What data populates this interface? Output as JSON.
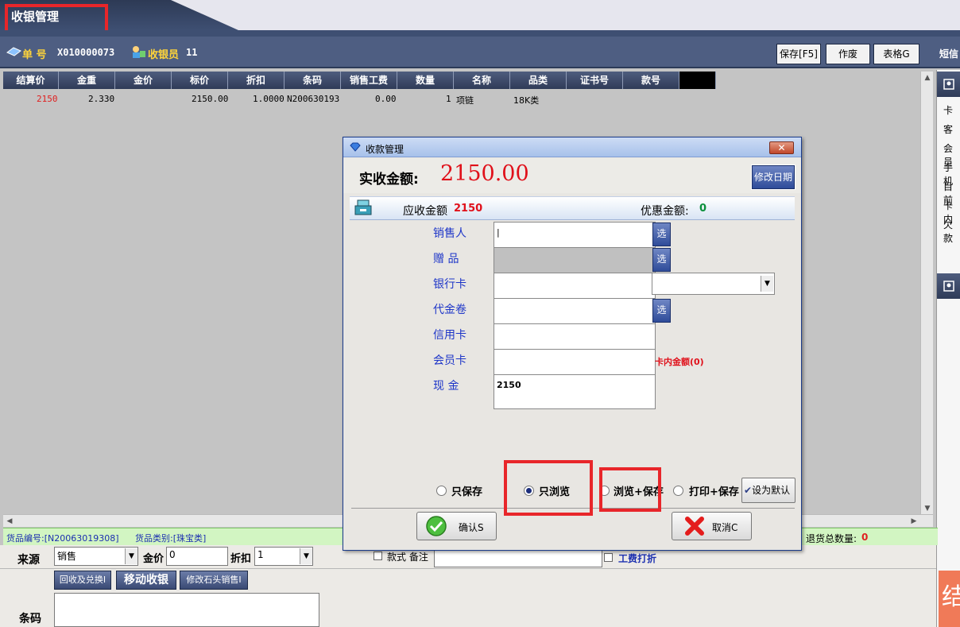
{
  "app": {
    "title": "收银管理"
  },
  "header": {
    "order_label": "单   号",
    "order_no": "X010000073",
    "cashier_label": "收银员",
    "cashier_value": "11",
    "buttons": {
      "save": "保存[F5]",
      "void": "作废",
      "table": "表格G",
      "sms": "短信"
    }
  },
  "grid": {
    "columns": [
      "结算价",
      "金重",
      "金价",
      "标价",
      "折扣",
      "条码",
      "销售工费",
      "数量",
      "名称",
      "品类",
      "证书号",
      "款号",
      ""
    ],
    "rows": [
      {
        "settle_price": "2150",
        "gold_weight": "2.330",
        "gold_price": "",
        "list_price": "2150.00",
        "discount": "1.0000",
        "barcode": "N200630193",
        "labor_fee": "0.00",
        "qty": "1",
        "name": "项链",
        "category": "18K类"
      }
    ]
  },
  "right_panel": {
    "labels": [
      "卡",
      "客",
      "会员",
      "手机",
      "目前",
      "卡内",
      "欠款"
    ],
    "bottom_char": "结"
  },
  "status_bar": {
    "item_no_label": "货品编号:[N20063019308]",
    "item_cat_label": "货品类别:[珠宝类]",
    "return_total_label": "退货总数量:",
    "return_total_value": "0"
  },
  "bottom_form": {
    "source_label": "来源",
    "source_value": "销售",
    "gold_price_label": "金价",
    "gold_price_value": "0",
    "discount_label": "折扣",
    "discount_value": "1",
    "style_note_label": "款式 备注",
    "labor_discount_label": "工费打折",
    "btn_recycle": "回收及兑换I",
    "btn_mobile": "移动收银",
    "btn_modify_stone": "修改石头销售I",
    "barcode_label": "条码"
  },
  "dialog": {
    "title": "收款管理",
    "close": "✕",
    "actual_label": "实收金额:",
    "actual_value": "2150.00",
    "modify_date": "修改日期",
    "due_label": "应收金额",
    "due_value": "2150",
    "discount_label": "优惠金额:",
    "discount_value": "0",
    "fields": {
      "salesperson": "销售人",
      "gift": "赠   品",
      "bank_card": "银行卡",
      "voucher": "代金卷",
      "credit_card": "信用卡",
      "member_card": "会员卡",
      "cash": "现   金"
    },
    "cash_value": "2150",
    "pick": "选",
    "card_balance": "卡内金额(0)",
    "radios": {
      "save_only": "只保存",
      "browse_only": "只浏览",
      "browse_save": "浏览+保存",
      "print_save": "打印+保存"
    },
    "set_default": "设为默认",
    "confirm": "确认S",
    "cancel": "取消C"
  },
  "colors": {
    "red": "#e8262a",
    "navy": "#3e4f72",
    "label_blue": "#1d35c8"
  }
}
